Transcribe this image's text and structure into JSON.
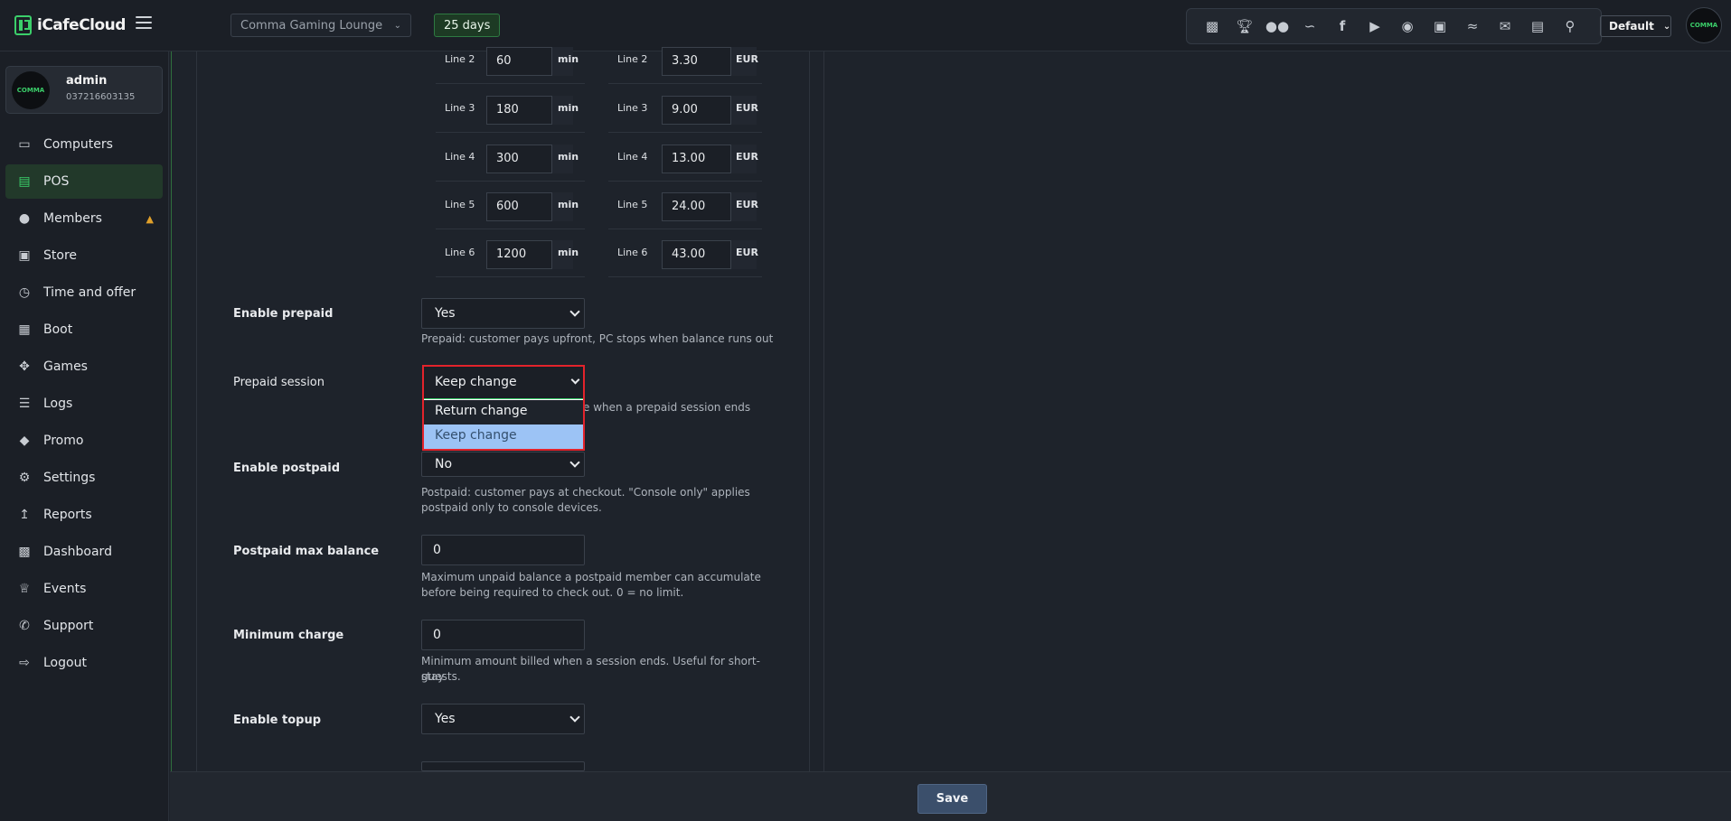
{
  "brand": {
    "name": "iCafeCloud"
  },
  "header": {
    "site_name": "Comma Gaming Lounge",
    "days_badge": "25 days",
    "language": "Default",
    "tray_icons": [
      "chart-icon",
      "trophy-icon",
      "users-icon",
      "rss-icon",
      "facebook-icon",
      "youtube-icon",
      "globe-icon",
      "app-logo-icon",
      "handshake-icon",
      "mail-icon",
      "chat-icon",
      "search-icon"
    ]
  },
  "user": {
    "name": "admin",
    "id": "037216603135",
    "avatar_text": "COMMA"
  },
  "sidebar": {
    "items": [
      {
        "label": "Computers",
        "icon": "monitor-icon"
      },
      {
        "label": "POS",
        "icon": "register-icon"
      },
      {
        "label": "Members",
        "icon": "users-icon"
      },
      {
        "label": "Store",
        "icon": "bag-icon"
      },
      {
        "label": "Time and offer",
        "icon": "stopwatch-icon"
      },
      {
        "label": "Boot",
        "icon": "windows-icon"
      },
      {
        "label": "Games",
        "icon": "gamepad-icon"
      },
      {
        "label": "Logs",
        "icon": "list-icon"
      },
      {
        "label": "Promo",
        "icon": "tag-icon"
      },
      {
        "label": "Settings",
        "icon": "gear-icon"
      },
      {
        "label": "Reports",
        "icon": "line-chart-icon"
      },
      {
        "label": "Dashboard",
        "icon": "grid-icon"
      },
      {
        "label": "Events",
        "icon": "crown-icon"
      },
      {
        "label": "Support",
        "icon": "phone-icon"
      },
      {
        "label": "Logout",
        "icon": "logout-icon"
      }
    ]
  },
  "price_lines": {
    "minutes": [
      {
        "label": "Line 2",
        "value": "60",
        "unit": "min"
      },
      {
        "label": "Line 3",
        "value": "180",
        "unit": "min"
      },
      {
        "label": "Line 4",
        "value": "300",
        "unit": "min"
      },
      {
        "label": "Line 5",
        "value": "600",
        "unit": "min"
      },
      {
        "label": "Line 6",
        "value": "1200",
        "unit": "min"
      }
    ],
    "prices": [
      {
        "label": "Line 2",
        "value": "3.30",
        "unit": "EUR"
      },
      {
        "label": "Line 3",
        "value": "9.00",
        "unit": "EUR"
      },
      {
        "label": "Line 4",
        "value": "13.00",
        "unit": "EUR"
      },
      {
        "label": "Line 5",
        "value": "24.00",
        "unit": "EUR"
      },
      {
        "label": "Line 6",
        "value": "43.00",
        "unit": "EUR"
      }
    ]
  },
  "settings": {
    "enable_prepaid": {
      "label": "Enable prepaid",
      "value": "Yes",
      "help": "Prepaid: customer pays upfront, PC stops when balance runs out"
    },
    "prepaid_session": {
      "label": "Prepaid session",
      "value": "Keep change",
      "help_visible": "e when a prepaid session ends",
      "options": [
        "Return change",
        "Keep change"
      ]
    },
    "enable_postpaid": {
      "label": "Enable postpaid",
      "value": "No",
      "help_1": "Postpaid: customer pays at checkout. \"Console only\" applies",
      "help_2": "postpaid only to console devices."
    },
    "postpaid_max_balance": {
      "label": "Postpaid max balance",
      "value": "0",
      "help_1": "Maximum unpaid balance a postpaid member can accumulate",
      "help_2": "before being required to check out. 0 = no limit."
    },
    "minimum_charge": {
      "label": "Minimum charge",
      "value": "0",
      "help_1": "Minimum amount billed when a session ends. Useful for short-stay",
      "help_2": "guests."
    },
    "enable_topup": {
      "label": "Enable topup",
      "value": "Yes"
    }
  },
  "footer": {
    "save_label": "Save"
  }
}
